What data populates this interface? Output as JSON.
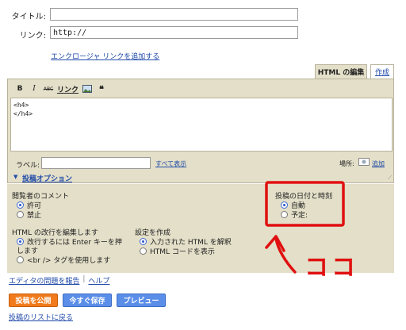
{
  "form": {
    "title_label": "タイトル:",
    "title_value": "",
    "link_label": "リンク:",
    "link_value": "http://",
    "enclosure_link": "エンクロージャ リンクを追加する"
  },
  "tabs": {
    "html": "HTML の編集",
    "compose": "作成"
  },
  "toolbar": {
    "bold": "B",
    "italic": "I",
    "strike": "ABC",
    "link": "リンク"
  },
  "editor": {
    "line1": "<h4>",
    "line2": "</h4>"
  },
  "labels_row": {
    "label": "ラベル:",
    "label_value": "",
    "show_all": "すべて表示",
    "location": "場所:",
    "add": "追加"
  },
  "options": {
    "toggle": "投稿オプション",
    "comments_title": "閲覧者のコメント",
    "allow": "許可",
    "deny": "禁止",
    "linebreak_title": "HTML の改行を編集します",
    "linebreak_opt1a": "改行するには Enter キーを押",
    "linebreak_opt1b": "します",
    "linebreak_opt2": "<br /> タグを使用します",
    "compose_title": "設定を作成",
    "compose_opt1": "入力された HTML を解釈",
    "compose_opt2": "HTML コードを表示",
    "date_title": "投稿の日付と時刻",
    "auto": "自動",
    "scheduled": "予定:"
  },
  "annotation": {
    "text": "ココ",
    "color": "#e01010"
  },
  "footer": {
    "report": "エディタの問題を報告",
    "sep": "|",
    "help": "ヘルプ",
    "publish": "投稿を公開",
    "save": "今すぐ保存",
    "preview": "プレビュー",
    "back": "投稿のリストに戻る"
  }
}
